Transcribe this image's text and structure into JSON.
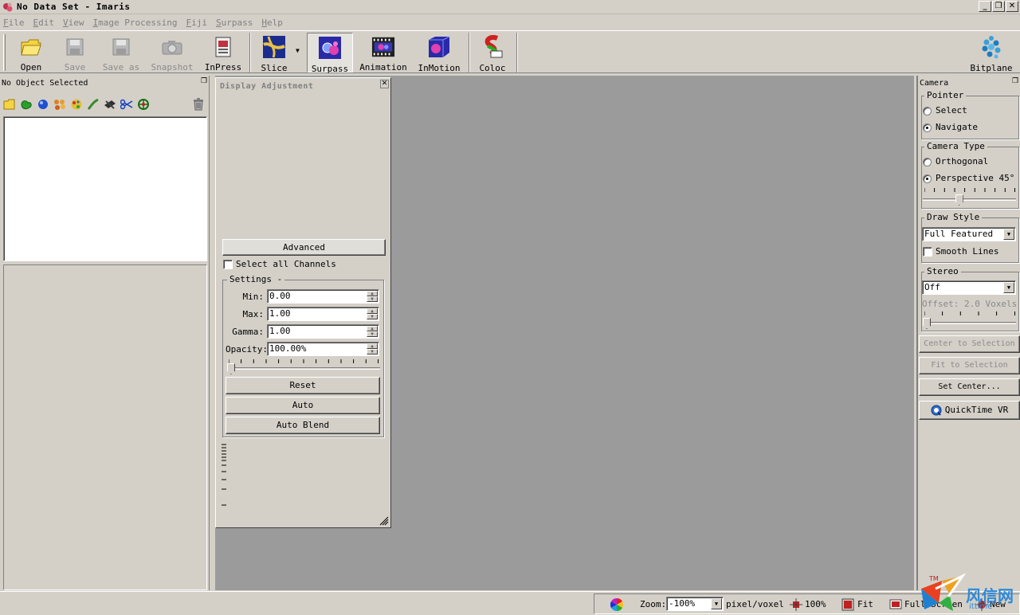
{
  "window": {
    "title": "No Data Set - Imaris",
    "minimize": "_",
    "restore": "❐",
    "close": "✕"
  },
  "menu": [
    "File",
    "Edit",
    "View",
    "Image Processing",
    "Fiji",
    "Surpass",
    "Help"
  ],
  "toolbar": {
    "open": "Open",
    "save": "Save",
    "save_as": "Save as",
    "snapshot": "Snapshot",
    "inpress": "InPress",
    "slice": "Slice",
    "surpass": "Surpass",
    "animation": "Animation",
    "inmotion": "InMotion",
    "coloc": "Coloc",
    "bitplane": "Bitplane"
  },
  "left_panel": {
    "title": "No Object Selected",
    "float_glyph": "❐"
  },
  "display_adjustment": {
    "title": "Display Adjustment",
    "close_glyph": "✕",
    "advanced": "Advanced",
    "select_all_channels": "Select all Channels",
    "settings_label": "Settings -",
    "min_label": "Min:",
    "min_value": "0.00",
    "max_label": "Max:",
    "max_value": "1.00",
    "gamma_label": "Gamma:",
    "gamma_value": "1.00",
    "opacity_label": "Opacity:",
    "opacity_value": "100.00%",
    "opacity_fraction": 0.0,
    "reset": "Reset",
    "auto": "Auto",
    "auto_blend": "Auto Blend"
  },
  "camera": {
    "title": "Camera",
    "float_glyph": "❐",
    "pointer_label": "Pointer",
    "select": "Select",
    "navigate": "Navigate",
    "camera_type_label": "Camera Type",
    "orthogonal": "Orthogonal",
    "perspective": "Perspective 45°",
    "perspective_fraction": 0.38,
    "draw_style_label": "Draw Style",
    "draw_style_value": "Full Featured",
    "smooth_lines": "Smooth Lines",
    "stereo_label": "Stereo",
    "stereo_value": "Off",
    "offset": "Offset: 2.0 Voxels",
    "offset_fraction": 0.0,
    "center_to_selection": "Center to Selection",
    "fit_to_selection": "Fit to Selection",
    "set_center": "Set Center...",
    "quicktime_vr": "QuickTime VR"
  },
  "status": {
    "zoom_label": "Zoom:",
    "zoom_value": "-100%",
    "unit": "pixel/voxel",
    "zoom_100": "100%",
    "fit": "Fit",
    "full": "Full Screen",
    "new": "New"
  },
  "watermark": {
    "text": "风信网",
    "url": "ittime"
  }
}
